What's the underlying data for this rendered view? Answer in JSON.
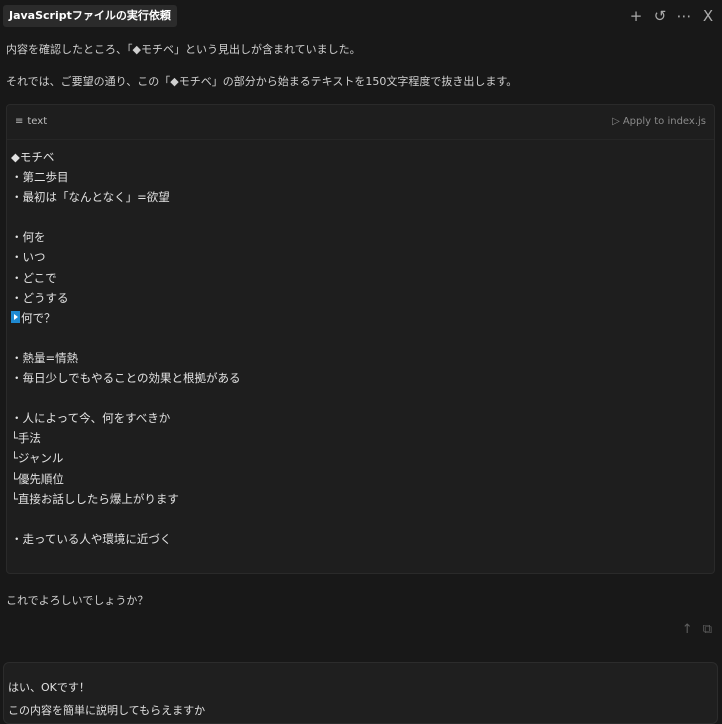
{
  "header": {
    "title": "JavaScriptファイルの実行依頼",
    "actions": [
      {
        "icon": "plus-icon",
        "glyph": "+"
      },
      {
        "icon": "history-icon",
        "glyph": "↺"
      },
      {
        "icon": "more-icon",
        "glyph": "⋯"
      },
      {
        "icon": "close-icon",
        "glyph": "X"
      }
    ]
  },
  "assistant": {
    "line1": "内容を確認したところ、「◆モチベ」という見出しが含まれていました。",
    "line2": "それでは、ご要望の通り、この「◆モチベ」の部分から始まるテキストを150文字程度で抜き出します。",
    "question": "これでよろしいでしょうか？"
  },
  "codeblock": {
    "language": "text",
    "language_icon": "text-lines-icon",
    "apply_label": "Apply to index.js",
    "apply_icon": "play-icon",
    "lines": [
      "◆モチベ",
      "・第二歩目",
      "・最初は「なんとなく」=欲望",
      "",
      "・何を",
      "・いつ",
      "・どこで",
      "・どうする",
      "何で？",
      "",
      "・熱量=情熱",
      "・毎日少しでもやることの効果と根拠がある",
      "",
      "・人によって今、何をすべきか",
      "└手法",
      "└ジャンル",
      "└優先順位",
      "└直接お話ししたら爆上がります",
      "",
      "・走っている人や環境に近づく"
    ],
    "marked_line_index": 8
  },
  "message_actions": {
    "scroll_up_icon": "arrow-up-icon",
    "copy_icon": "copy-icon",
    "scroll_up_glyph": "↑",
    "copy_glyph": "⧉"
  },
  "input": {
    "line1": "はい、OKです！",
    "line2": "この内容を簡単に説明してもらえますか"
  }
}
